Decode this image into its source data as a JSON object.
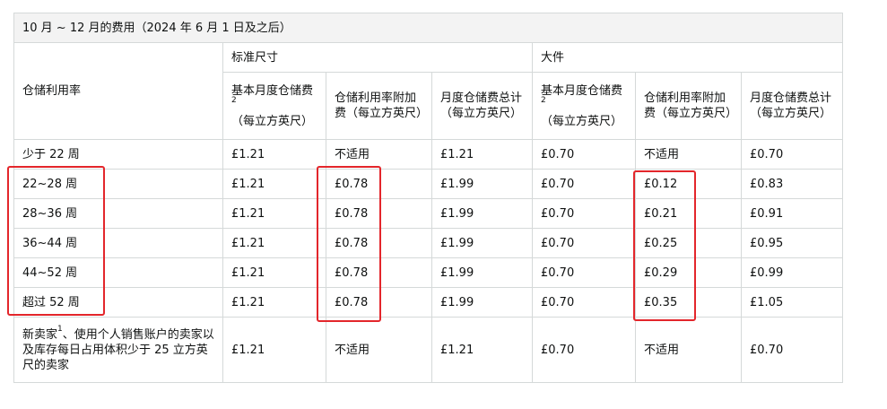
{
  "table": {
    "title": "10 月 ~ 12 月的费用（2024 年 6 月 1 日及之后）",
    "row_header": "仓储利用率",
    "groups": [
      {
        "label": "标准尺寸"
      },
      {
        "label": "大件"
      }
    ],
    "columns": [
      {
        "text": "基本月度仓储费",
        "sup": "2",
        "suffix": "（每立方英尺）"
      },
      {
        "text": "仓储利用率附加费（每立方英尺）",
        "sup": "",
        "suffix": ""
      },
      {
        "text": "月度仓储费总计（每立方英尺）",
        "sup": "",
        "suffix": ""
      },
      {
        "text": "基本月度仓储费",
        "sup": "2",
        "suffix": "（每立方英尺）"
      },
      {
        "text": "仓储利用率附加费（每立方英尺）",
        "sup": "",
        "suffix": ""
      },
      {
        "text": "月度仓储费总计（每立方英尺）",
        "sup": "",
        "suffix": ""
      }
    ],
    "rows": [
      {
        "label": "少于 22 周",
        "cells": [
          "£1.21",
          "不适用",
          "£1.21",
          "£0.70",
          "不适用",
          "£0.70"
        ]
      },
      {
        "label": "22~28 周",
        "cells": [
          "£1.21",
          "£0.78",
          "£1.99",
          "£0.70",
          "£0.12",
          "£0.83"
        ]
      },
      {
        "label": "28~36 周",
        "cells": [
          "£1.21",
          "£0.78",
          "£1.99",
          "£0.70",
          "£0.21",
          "£0.91"
        ]
      },
      {
        "label": "36~44 周",
        "cells": [
          "£1.21",
          "£0.78",
          "£1.99",
          "£0.70",
          "£0.25",
          "£0.95"
        ]
      },
      {
        "label": "44~52 周",
        "cells": [
          "£1.21",
          "£0.78",
          "£1.99",
          "£0.70",
          "£0.29",
          "£0.99"
        ]
      },
      {
        "label": "超过 52 周",
        "cells": [
          "£1.21",
          "£0.78",
          "£1.99",
          "£0.70",
          "£0.35",
          "£1.05"
        ]
      }
    ],
    "last_row": {
      "label_prefix": "新卖家",
      "label_sup": "1",
      "label_suffix": "、使用个人销售账户的卖家以及库存每日占用体积少于 25 立方英尺的卖家",
      "cells": [
        "£1.21",
        "不适用",
        "£1.21",
        "£0.70",
        "不适用",
        "£0.70"
      ]
    }
  },
  "highlight_color": "#e3262b"
}
